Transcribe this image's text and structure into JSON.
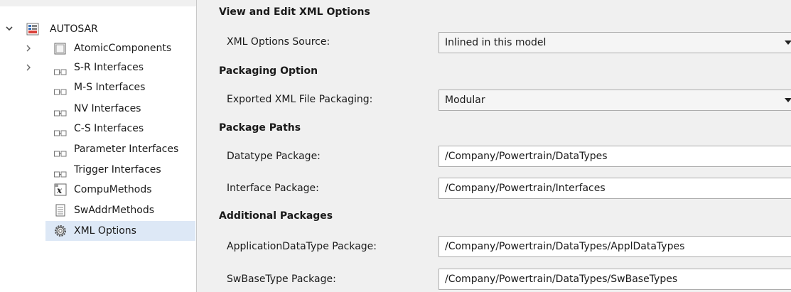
{
  "tree": {
    "root": {
      "label": "AUTOSAR",
      "icon": "autosar-package-icon"
    },
    "items": [
      {
        "label": "AtomicComponents",
        "icon": "component-box-icon",
        "expandable": true
      },
      {
        "label": "S-R Interfaces",
        "icon": "interface-icon",
        "expandable": true
      },
      {
        "label": "M-S Interfaces",
        "icon": "interface-icon",
        "expandable": false
      },
      {
        "label": "NV Interfaces",
        "icon": "interface-icon",
        "expandable": false
      },
      {
        "label": "C-S Interfaces",
        "icon": "interface-icon",
        "expandable": false
      },
      {
        "label": "Parameter Interfaces",
        "icon": "interface-icon",
        "expandable": false
      },
      {
        "label": "Trigger Interfaces",
        "icon": "interface-icon",
        "expandable": false
      },
      {
        "label": "CompuMethods",
        "icon": "compu-method-icon",
        "expandable": false
      },
      {
        "label": "SwAddrMethods",
        "icon": "document-icon",
        "expandable": false
      },
      {
        "label": "XML Options",
        "icon": "gear-icon",
        "expandable": false,
        "selected": true
      }
    ]
  },
  "panel": {
    "title": "View and Edit XML Options",
    "xml_source": {
      "label": "XML Options Source:",
      "value": "Inlined in this model"
    },
    "packaging": {
      "heading": "Packaging Option",
      "label": "Exported XML File Packaging:",
      "value": "Modular"
    },
    "paths": {
      "heading": "Package Paths",
      "datatype": {
        "label": "Datatype Package:",
        "value": "/Company/Powertrain/DataTypes"
      },
      "interface": {
        "label": "Interface Package:",
        "value": "/Company/Powertrain/Interfaces"
      }
    },
    "additional": {
      "heading": "Additional Packages",
      "appl": {
        "label": "ApplicationDataType Package:",
        "value": "/Company/Powertrain/DataTypes/ApplDataTypes"
      },
      "swbase": {
        "label": "SwBaseType Package:",
        "value": "/Company/Powertrain/DataTypes/SwBaseTypes"
      }
    }
  },
  "colors": {
    "selection": "#dde8f6",
    "panel_bg": "#f0f0f0",
    "field_border": "#adadad"
  }
}
